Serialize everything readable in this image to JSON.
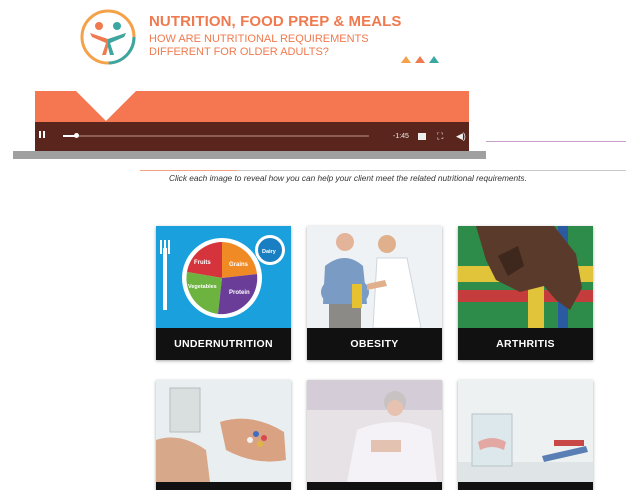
{
  "header": {
    "title": "NUTRITION, FOOD PREP & MEALS",
    "subtitle": "HOW ARE NUTRITIONAL REQUIREMENTS DIFFERENT FOR OLDER ADULTS?"
  },
  "video": {
    "time_remaining": "-1:45"
  },
  "instruction": "Click each image to reveal how you can help your client meet the related nutritional requirements.",
  "plate_graphic": {
    "fruits": "Fruits",
    "grains": "Grains",
    "vegetables": "Vegetables",
    "protein": "Protein",
    "dairy": "Dairy"
  },
  "cards": [
    {
      "label": "UNDERNUTRITION"
    },
    {
      "label": "OBESITY"
    },
    {
      "label": "ARTHRITIS"
    },
    {
      "label": ""
    },
    {
      "label": ""
    },
    {
      "label": ""
    }
  ],
  "colors": {
    "accent": "#f07a4f",
    "banner": "#f57752",
    "controls": "#5a251c"
  }
}
